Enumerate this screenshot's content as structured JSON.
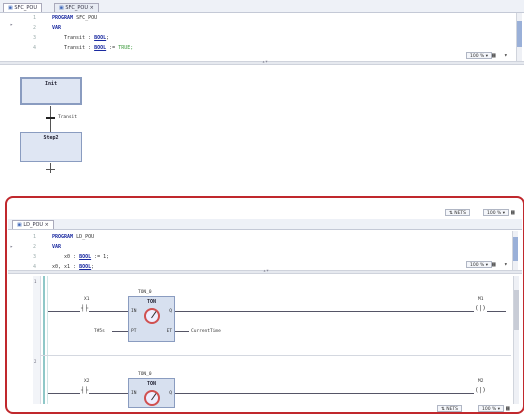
{
  "top_editor": {
    "tabs": [
      {
        "label": "SFC_POU"
      },
      {
        "label": "SFC_POU"
      }
    ],
    "code_lines": [
      {
        "num": "1",
        "kw": "PROGRAM",
        "rest": " SFC_POU"
      },
      {
        "num": "2",
        "kw": "VAR",
        "rest": ""
      },
      {
        "num": "3",
        "var": "Transit",
        "assign": " : ",
        "type": "BOOL",
        "tail": ";"
      },
      {
        "num": "4",
        "var": "Transit",
        "assign": " : ",
        "type": "BOOL",
        "tail": " := ",
        "cmt": "TRUE;"
      }
    ],
    "zoom": "100 %",
    "sfc": {
      "init_step": "Init",
      "transition": "Transit",
      "step2": "Step2"
    }
  },
  "lower_toolbar": {
    "left_btn": "NETS",
    "zoom": "100 %"
  },
  "bottom_editor": {
    "tab": "LD_POU",
    "code_lines": [
      {
        "num": "1",
        "kw": "PROGRAM",
        "rest": " LD_POU"
      },
      {
        "num": "2",
        "kw": "VAR",
        "rest": ""
      },
      {
        "num": "3",
        "var": "x0",
        "assign": " : ",
        "type": "BOOL",
        "tail": " := 1;"
      },
      {
        "num": "4",
        "var": "x0, x1",
        "assign": " : ",
        "type": "BOOL",
        "tail": ";"
      }
    ],
    "zoom": "100 %",
    "networks": [
      {
        "contact_in": "X1",
        "fb_instance": "TON_0",
        "fb_type": "TON",
        "in_pin": "IN",
        "q_pin": "Q",
        "pt_pin": "PT",
        "et_pin": "ET",
        "pt_value": "T#5s",
        "et_value": "CurrentTime",
        "coil_out": "M1"
      },
      {
        "contact_in": "X2",
        "fb_instance": "TON_0",
        "fb_type": "TON",
        "in_pin": "IN",
        "q_pin": "Q",
        "coil_out": "M2"
      }
    ]
  },
  "status_bar": {
    "left_btn": "NETS",
    "zoom": "100 %"
  }
}
